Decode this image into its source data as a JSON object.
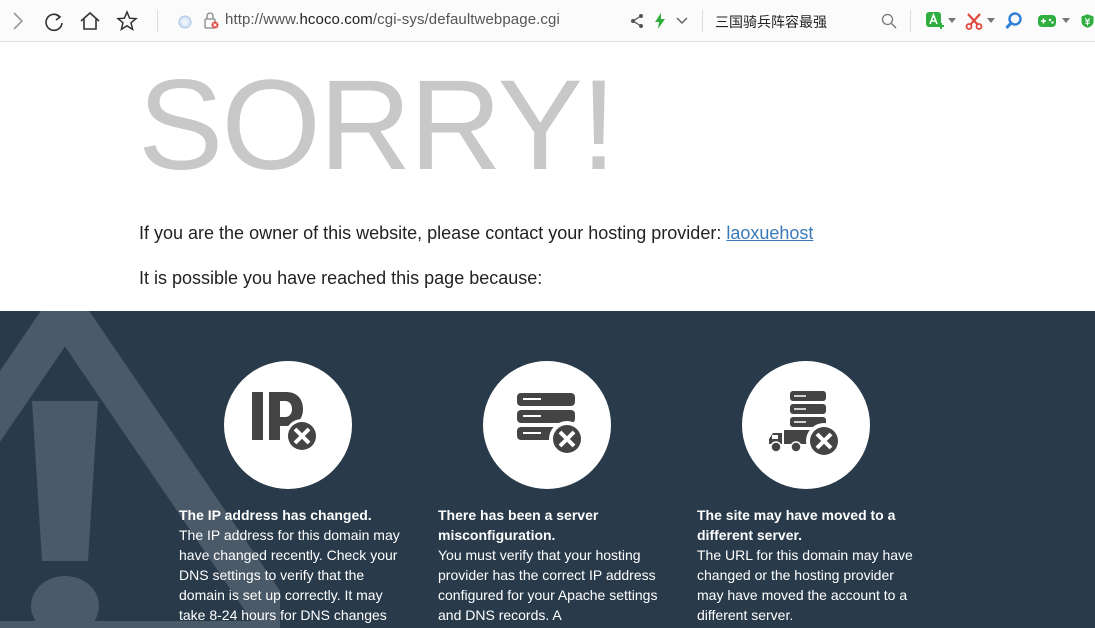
{
  "browser": {
    "url_prefix": "http://www.",
    "url_domain": "hcoco.com",
    "url_path": "/cgi-sys/defaultwebpage.cgi",
    "search_query": "三国骑兵阵容最强",
    "icons": [
      "back-icon",
      "refresh-icon",
      "home-icon",
      "star-icon",
      "page-icon",
      "lock-icon",
      "share-icon",
      "lightning-icon",
      "chevron-down-icon",
      "search-icon",
      "translate-icon",
      "scissors-icon",
      "magnifier-icon",
      "gamepad-icon",
      "coin-icon"
    ]
  },
  "page": {
    "heading": "SORRY!",
    "owner_text": "If you are the owner of this website, please contact your hosting provider: ",
    "owner_link": "laoxuehost",
    "possible_text": "It is possible you have reached this page because:",
    "reasons": [
      {
        "title": "The IP address has changed.",
        "body": "The IP address for this domain may have changed recently. Check your DNS settings to verify that the domain is set up correctly. It may take 8-24 hours for DNS changes"
      },
      {
        "title": "There has been a server misconfiguration.",
        "body": "You must verify that your hosting provider has the correct IP address configured for your Apache settings and DNS records. A"
      },
      {
        "title": "The site may have moved to a different server.",
        "body": "The URL for this domain may have changed or the hosting provider may have moved the account to a different server."
      }
    ]
  },
  "colors": {
    "dark_band": "#293a4a",
    "heading": "#c8c8c8",
    "link": "#3a7ab8",
    "icon": "#444444"
  }
}
